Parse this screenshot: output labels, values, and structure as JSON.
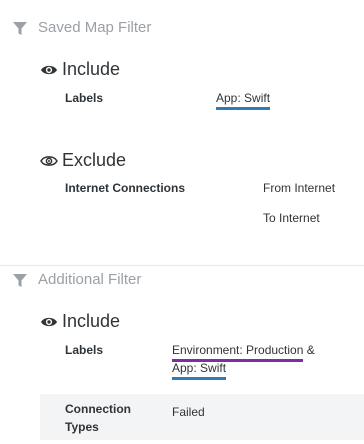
{
  "saved_filter": {
    "title": "Saved Map Filter",
    "include": {
      "title": "Include",
      "rows": [
        {
          "label": "Labels",
          "tags": [
            "App: Swift"
          ]
        }
      ]
    },
    "exclude": {
      "title": "Exclude",
      "rows": [
        {
          "label": "Internet Connections",
          "values": [
            "From Internet",
            "To Internet"
          ]
        }
      ]
    }
  },
  "additional_filter": {
    "title": "Additional Filter",
    "include": {
      "title": "Include",
      "rows": [
        {
          "label": "Labels",
          "tags": [
            "Environment: Production",
            "App: Swift"
          ],
          "joiner": "&"
        },
        {
          "label": "Connection Types",
          "value": "Failed"
        }
      ]
    }
  },
  "colors": {
    "tag_blue": "#2e7bb6",
    "tag_purple": "#7b2ea6",
    "muted_text": "#9aa0a6",
    "shaded_row": "#f3f4f5"
  },
  "icons": [
    "filter-icon",
    "eye-icon",
    "eye-outline-icon"
  ]
}
